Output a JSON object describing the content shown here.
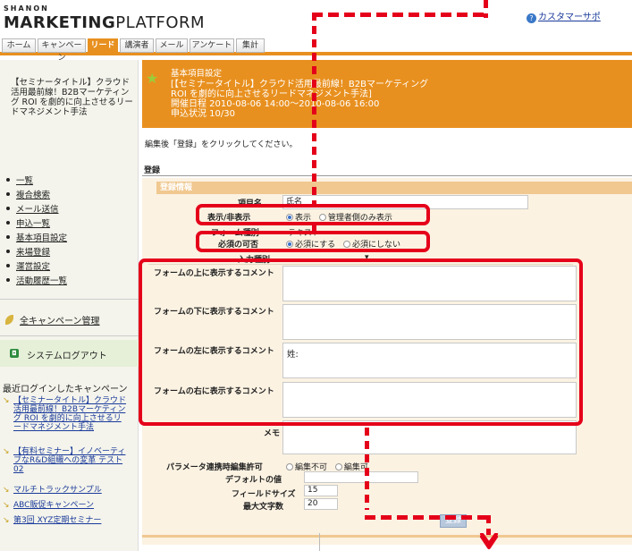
{
  "header": {
    "brand_small": "SHANON",
    "brand_big_bold": "MARKETING",
    "brand_big_light": "PLATFORM",
    "support_link": "カスタマーサポ"
  },
  "tabs": [
    {
      "label": "ホーム",
      "active": false
    },
    {
      "label": "キャンペーン",
      "active": false
    },
    {
      "label": "リード",
      "active": true
    },
    {
      "label": "講演者",
      "active": false
    },
    {
      "label": "メール",
      "active": false
    },
    {
      "label": "アンケート",
      "active": false
    },
    {
      "label": "集計",
      "active": false
    }
  ],
  "sidebar": {
    "title": "【セミナータイトル】クラウド活用最前線！B2Bマーケティング ROI を劇的に向上させるリードマネジメント手法",
    "links": [
      "一覧",
      "複合検索",
      "メール送信",
      "申込一覧",
      "基本項目設定",
      "来場登録",
      "運営設定",
      "活動履歴一覧"
    ],
    "all_campaigns": "全キャンペーン管理",
    "logout": "システムログアウト",
    "recent_title": "最近ログインしたキャンペーン",
    "recent_items": [
      "【セミナータイトル】クラウド活用最前線！B2Bマーケティング ROI を劇的に向上させるリードマネジメント手法",
      "【有料セミナー】イノベーティブなR&D組織への変革 テスト02",
      "マルチトラックサンプル",
      "ABC販促キャンペーン",
      "第3回 XYZ定期セミナー"
    ]
  },
  "main_header": {
    "line1": "基本項目設定",
    "line2": "[【セミナータイトル】クラウド活用最前線！B2Bマーケティング",
    "line3": "ROI を劇的に向上させるリードマネジメント手法]",
    "line4": "開催日程 2010-08-06 14:00～2010-08-06 16:00",
    "line5": "申込状況 10/30"
  },
  "instruction": "編集後「登録」をクリックしてください。",
  "section_label": "登録",
  "panel_title": "登録情報",
  "form": {
    "item_name_label": "項目名",
    "item_name_value": "氏名",
    "visibility_label": "表示/非表示",
    "visibility_options": [
      "表示",
      "管理者側のみ表示"
    ],
    "form_type_label": "フォーム種別",
    "form_type_value": "テキスト",
    "required_label": "必須の可否",
    "required_options": [
      "必須にする",
      "必須にしない"
    ],
    "input_type_label": "入力種別",
    "comment_above_label": "フォームの上に表示するコメント",
    "comment_below_label": "フォームの下に表示するコメント",
    "comment_left_label": "フォームの左に表示するコメント",
    "comment_left_value": "姓:",
    "comment_right_label": "フォームの右に表示するコメント",
    "memo_label": "メモ",
    "param_edit_label": "パラメータ連携時編集許可",
    "param_edit_options": [
      "編集不可",
      "編集可"
    ],
    "default_label": "デフォルトの値",
    "field_size_label": "フィールドサイズ",
    "field_size_value": "15",
    "max_chars_label": "最大文字数",
    "max_chars_value": "20"
  },
  "submit_label": "登録",
  "colors": {
    "accent_orange": "#e8901f",
    "annotation_red": "#e5001a"
  }
}
